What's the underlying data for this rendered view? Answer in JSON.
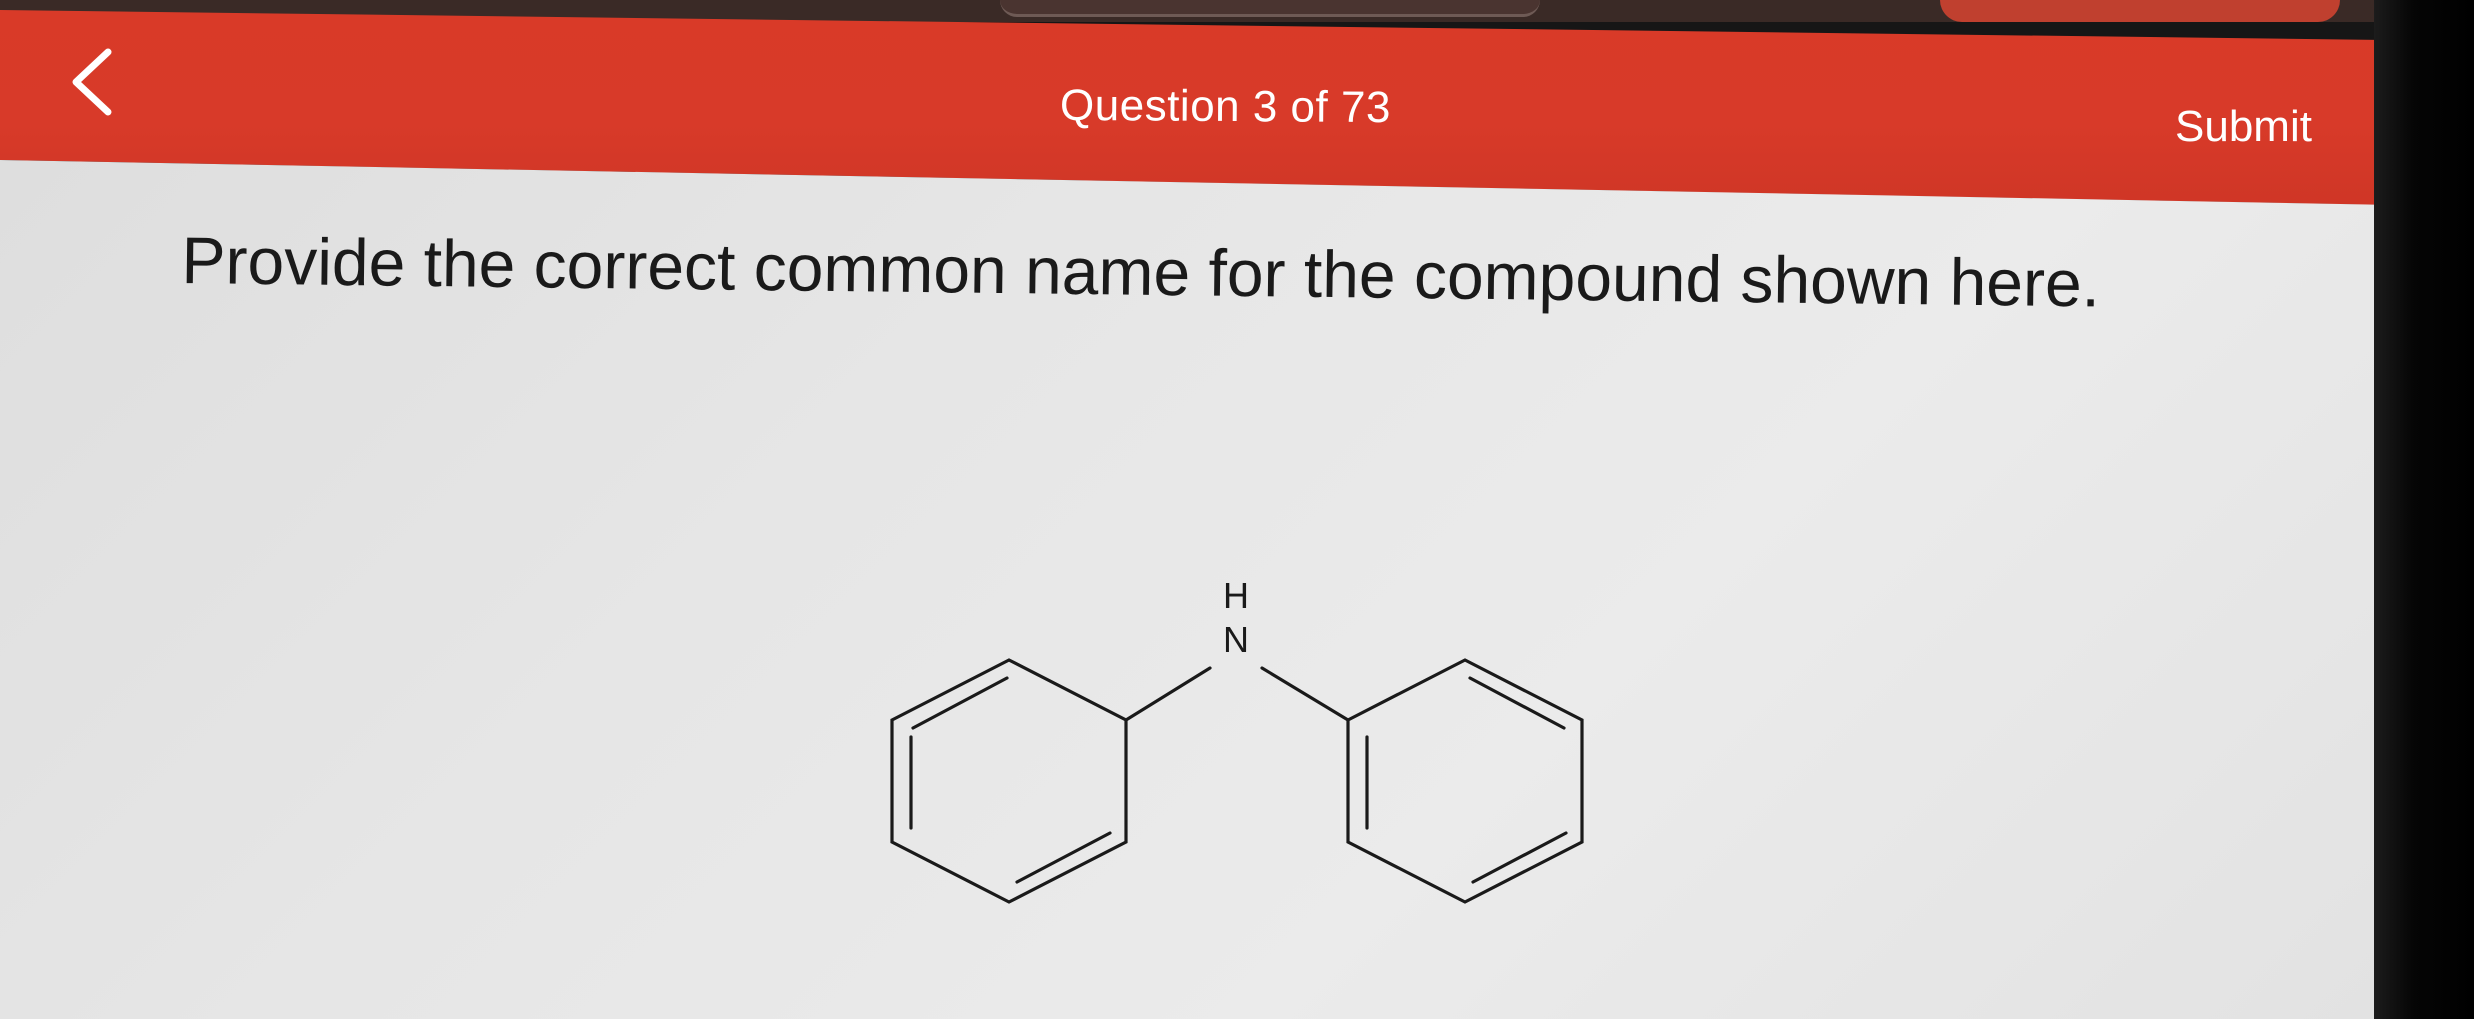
{
  "header": {
    "back_icon": "chevron-left-icon",
    "title": "Question 3 of 73",
    "submit_label": "Submit"
  },
  "question": {
    "prompt": "Provide the correct common name for the compound shown here.",
    "structure": {
      "atom_labels": {
        "h": "H",
        "n": "N"
      }
    }
  },
  "colors": {
    "header_red": "#d93a28",
    "header_text": "#ffffff",
    "page_background": "#e6e6e6",
    "text": "#1a1a1a"
  }
}
